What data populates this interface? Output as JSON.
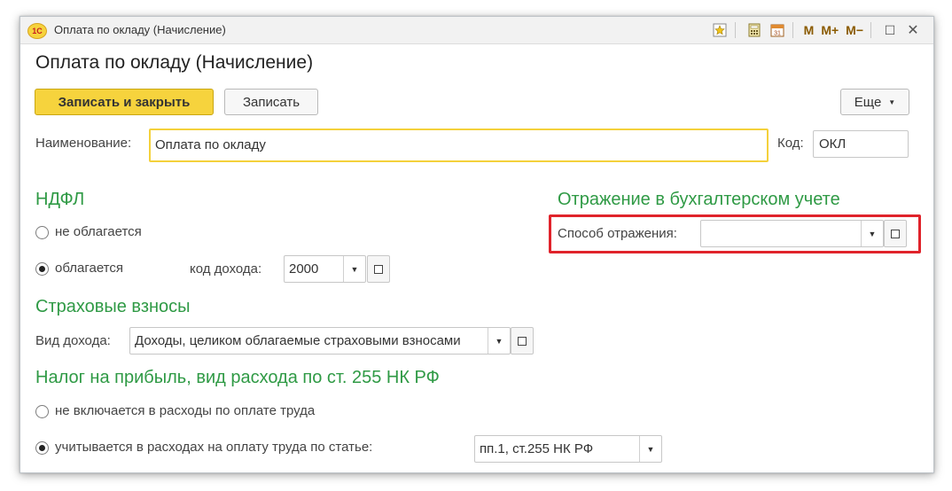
{
  "window": {
    "title": "Оплата по окладу (Начисление)",
    "app_icon": "1C",
    "toolbar": {
      "m": "M",
      "m_plus": "M+",
      "m_minus": "M−",
      "restore": "☐",
      "close": "✕",
      "calendar_day": "31"
    }
  },
  "form": {
    "title": "Оплата по окладу (Начисление)",
    "buttons": {
      "save_close": "Записать и закрыть",
      "save": "Записать",
      "more": "Еще"
    },
    "name": {
      "label": "Наименование:",
      "value": "Оплата по окладу"
    },
    "code": {
      "label": "Код:",
      "value": "ОКЛ"
    }
  },
  "ndfl": {
    "title": "НДФЛ",
    "option_not_taxed": "не облагается",
    "option_taxed": "облагается",
    "selected": "облагается",
    "income_code_label": "код дохода:",
    "income_code_value": "2000"
  },
  "accounting": {
    "title": "Отражение в бухгалтерском учете",
    "method_label": "Способ отражения:",
    "method_value": ""
  },
  "insurance": {
    "title": "Страховые взносы",
    "income_type_label": "Вид дохода:",
    "income_type_value": "Доходы, целиком облагаемые страховыми взносами"
  },
  "profit_tax": {
    "title": "Налог на прибыль, вид расхода по ст. 255 НК РФ",
    "option_not_included": "не включается в расходы по оплате труда",
    "option_included": "учитывается в расходах на оплату труда по статье:",
    "selected": "учитывается в расходах на оплату труда по статье:",
    "article_value": "пп.1, ст.255 НК РФ"
  },
  "colors": {
    "accent_yellow": "#f6d33d",
    "section_green": "#2f9a45",
    "highlight_red": "#e0232b"
  }
}
